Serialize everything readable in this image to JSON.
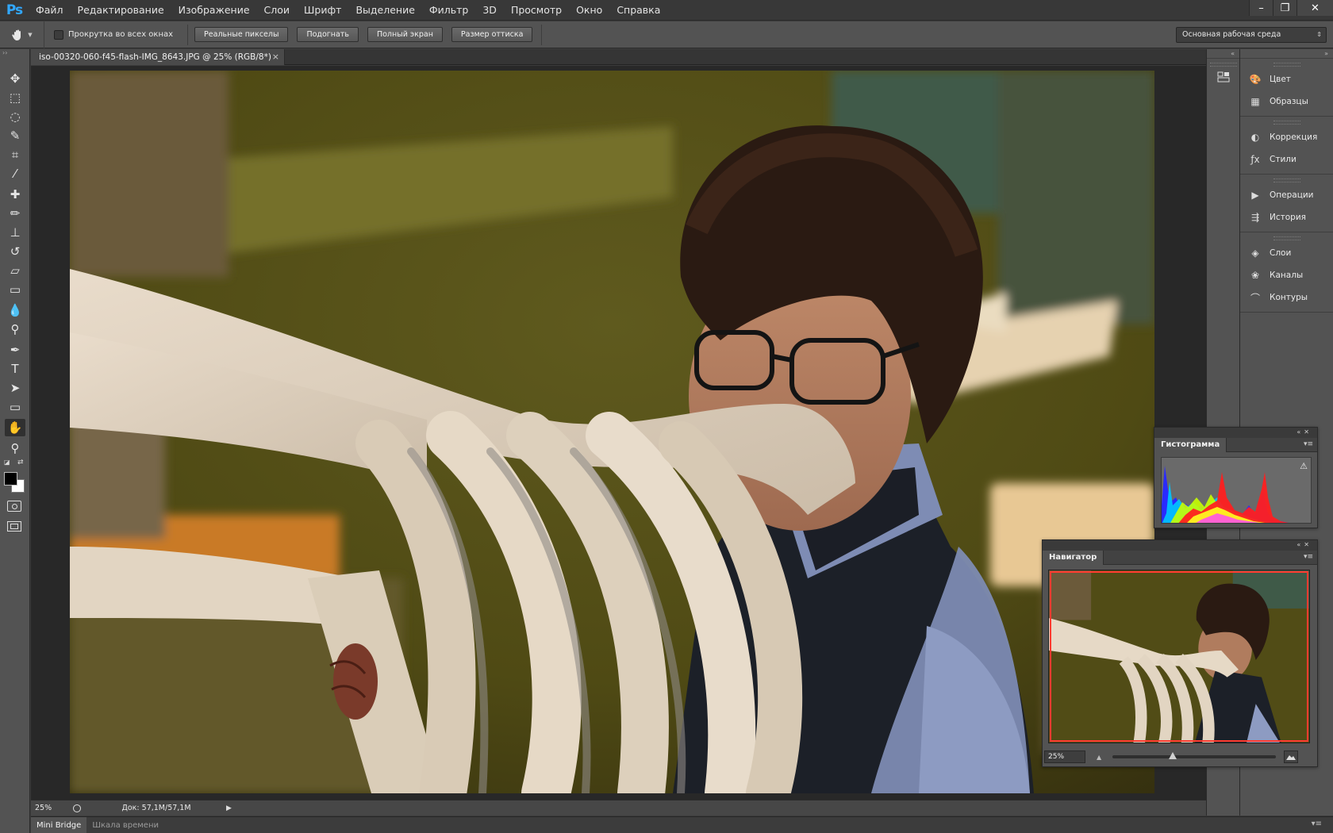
{
  "app": {
    "logo": "Ps"
  },
  "menubar": {
    "items": [
      "Файл",
      "Редактирование",
      "Изображение",
      "Слои",
      "Шрифт",
      "Выделение",
      "Фильтр",
      "3D",
      "Просмотр",
      "Окно",
      "Справка"
    ]
  },
  "window_controls": {
    "minimize": "–",
    "restore": "❐",
    "close": "✕"
  },
  "options": {
    "scroll_all_windows_label": "Прокрутка во всех окнах",
    "scroll_all_windows_checked": false,
    "buttons": [
      "Реальные пикселы",
      "Подогнать",
      "Полный экран",
      "Размер оттиска"
    ],
    "workspace": "Основная рабочая среда"
  },
  "tools": [
    {
      "name": "move-tool-icon",
      "glyph": "✥"
    },
    {
      "name": "marquee-tool-icon",
      "glyph": "⬚"
    },
    {
      "name": "lasso-tool-icon",
      "glyph": "◌"
    },
    {
      "name": "quick-selection-tool-icon",
      "glyph": "✎"
    },
    {
      "name": "crop-tool-icon",
      "glyph": "⌗"
    },
    {
      "name": "eyedropper-tool-icon",
      "glyph": "⁄"
    },
    {
      "name": "healing-brush-tool-icon",
      "glyph": "✚"
    },
    {
      "name": "brush-tool-icon",
      "glyph": "✏"
    },
    {
      "name": "clone-stamp-tool-icon",
      "glyph": "⊥"
    },
    {
      "name": "history-brush-tool-icon",
      "glyph": "↺"
    },
    {
      "name": "eraser-tool-icon",
      "glyph": "▱"
    },
    {
      "name": "gradient-tool-icon",
      "glyph": "▭"
    },
    {
      "name": "blur-tool-icon",
      "glyph": "💧"
    },
    {
      "name": "dodge-tool-icon",
      "glyph": "⚲"
    },
    {
      "name": "pen-tool-icon",
      "glyph": "✒"
    },
    {
      "name": "type-tool-icon",
      "glyph": "T"
    },
    {
      "name": "path-selection-tool-icon",
      "glyph": "➤"
    },
    {
      "name": "rectangle-tool-icon",
      "glyph": "▭"
    },
    {
      "name": "hand-tool-icon",
      "glyph": "✋"
    },
    {
      "name": "zoom-tool-icon",
      "glyph": "⚲"
    }
  ],
  "colors": {
    "foreground": "#000000",
    "background": "#ffffff",
    "accent_ps": "#31a8ff",
    "nav_proxy": "#ff3b30"
  },
  "document": {
    "tab_title": "iso-00320-060-f45-flash-IMG_8643.JPG @ 25% (RGB/8*)",
    "close_glyph": "×"
  },
  "status": {
    "zoom": "25%",
    "doc_size": "Док: 57,1M/57,1M",
    "arrow": "▶"
  },
  "bottom_tabs": [
    "Mini Bridge",
    "Шкала времени"
  ],
  "dock": {
    "groups": [
      [
        {
          "label": "Цвет",
          "icon": "color-icon"
        },
        {
          "label": "Образцы",
          "icon": "swatches-icon"
        }
      ],
      [
        {
          "label": "Коррекция",
          "icon": "adjustments-icon"
        },
        {
          "label": "Стили",
          "icon": "styles-icon"
        }
      ],
      [
        {
          "label": "Операции",
          "icon": "actions-icon"
        },
        {
          "label": "История",
          "icon": "history-icon"
        }
      ],
      [
        {
          "label": "Слои",
          "icon": "layers-icon"
        },
        {
          "label": "Каналы",
          "icon": "channels-icon"
        },
        {
          "label": "Контуры",
          "icon": "paths-icon"
        }
      ]
    ]
  },
  "histogram": {
    "tab_label": "Гистограмма",
    "warning_glyph": "⚠"
  },
  "navigator": {
    "tab_label": "Навигатор",
    "zoom": "25%",
    "zoom_level": 0.37
  }
}
